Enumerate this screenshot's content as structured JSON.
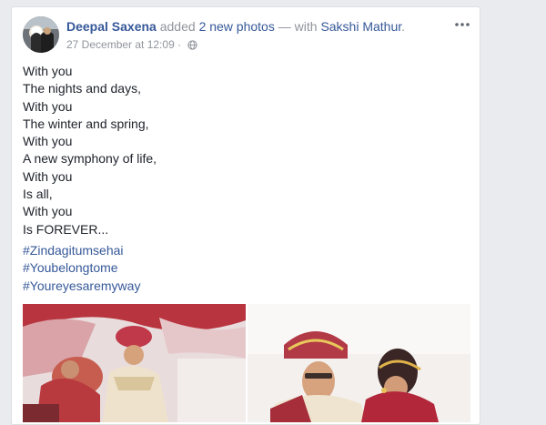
{
  "post": {
    "author": "Deepal Saxena",
    "action_prefix": "added",
    "photos_link": "2 new photos",
    "with_text": "— with",
    "tagged": "Sakshi Mathur",
    "end_punct": ".",
    "timestamp": "27 December at 12:09",
    "separator": "·",
    "more_icon": "more-options-icon",
    "privacy_icon": "globe-icon",
    "lines": [
      "With you",
      "The nights and days,",
      "With you",
      "The winter and spring,",
      "With you",
      "A new symphony of life,",
      "With you",
      "Is all,",
      "With you",
      "Is FOREVER..."
    ],
    "hashtags": [
      "#Zindagitumsehai",
      "#Youbelongtome",
      "#Youreyesaremyway"
    ]
  },
  "colors": {
    "link": "#365899",
    "text": "#1d2129",
    "meta": "#90949c",
    "page_bg": "#e9ebee"
  }
}
